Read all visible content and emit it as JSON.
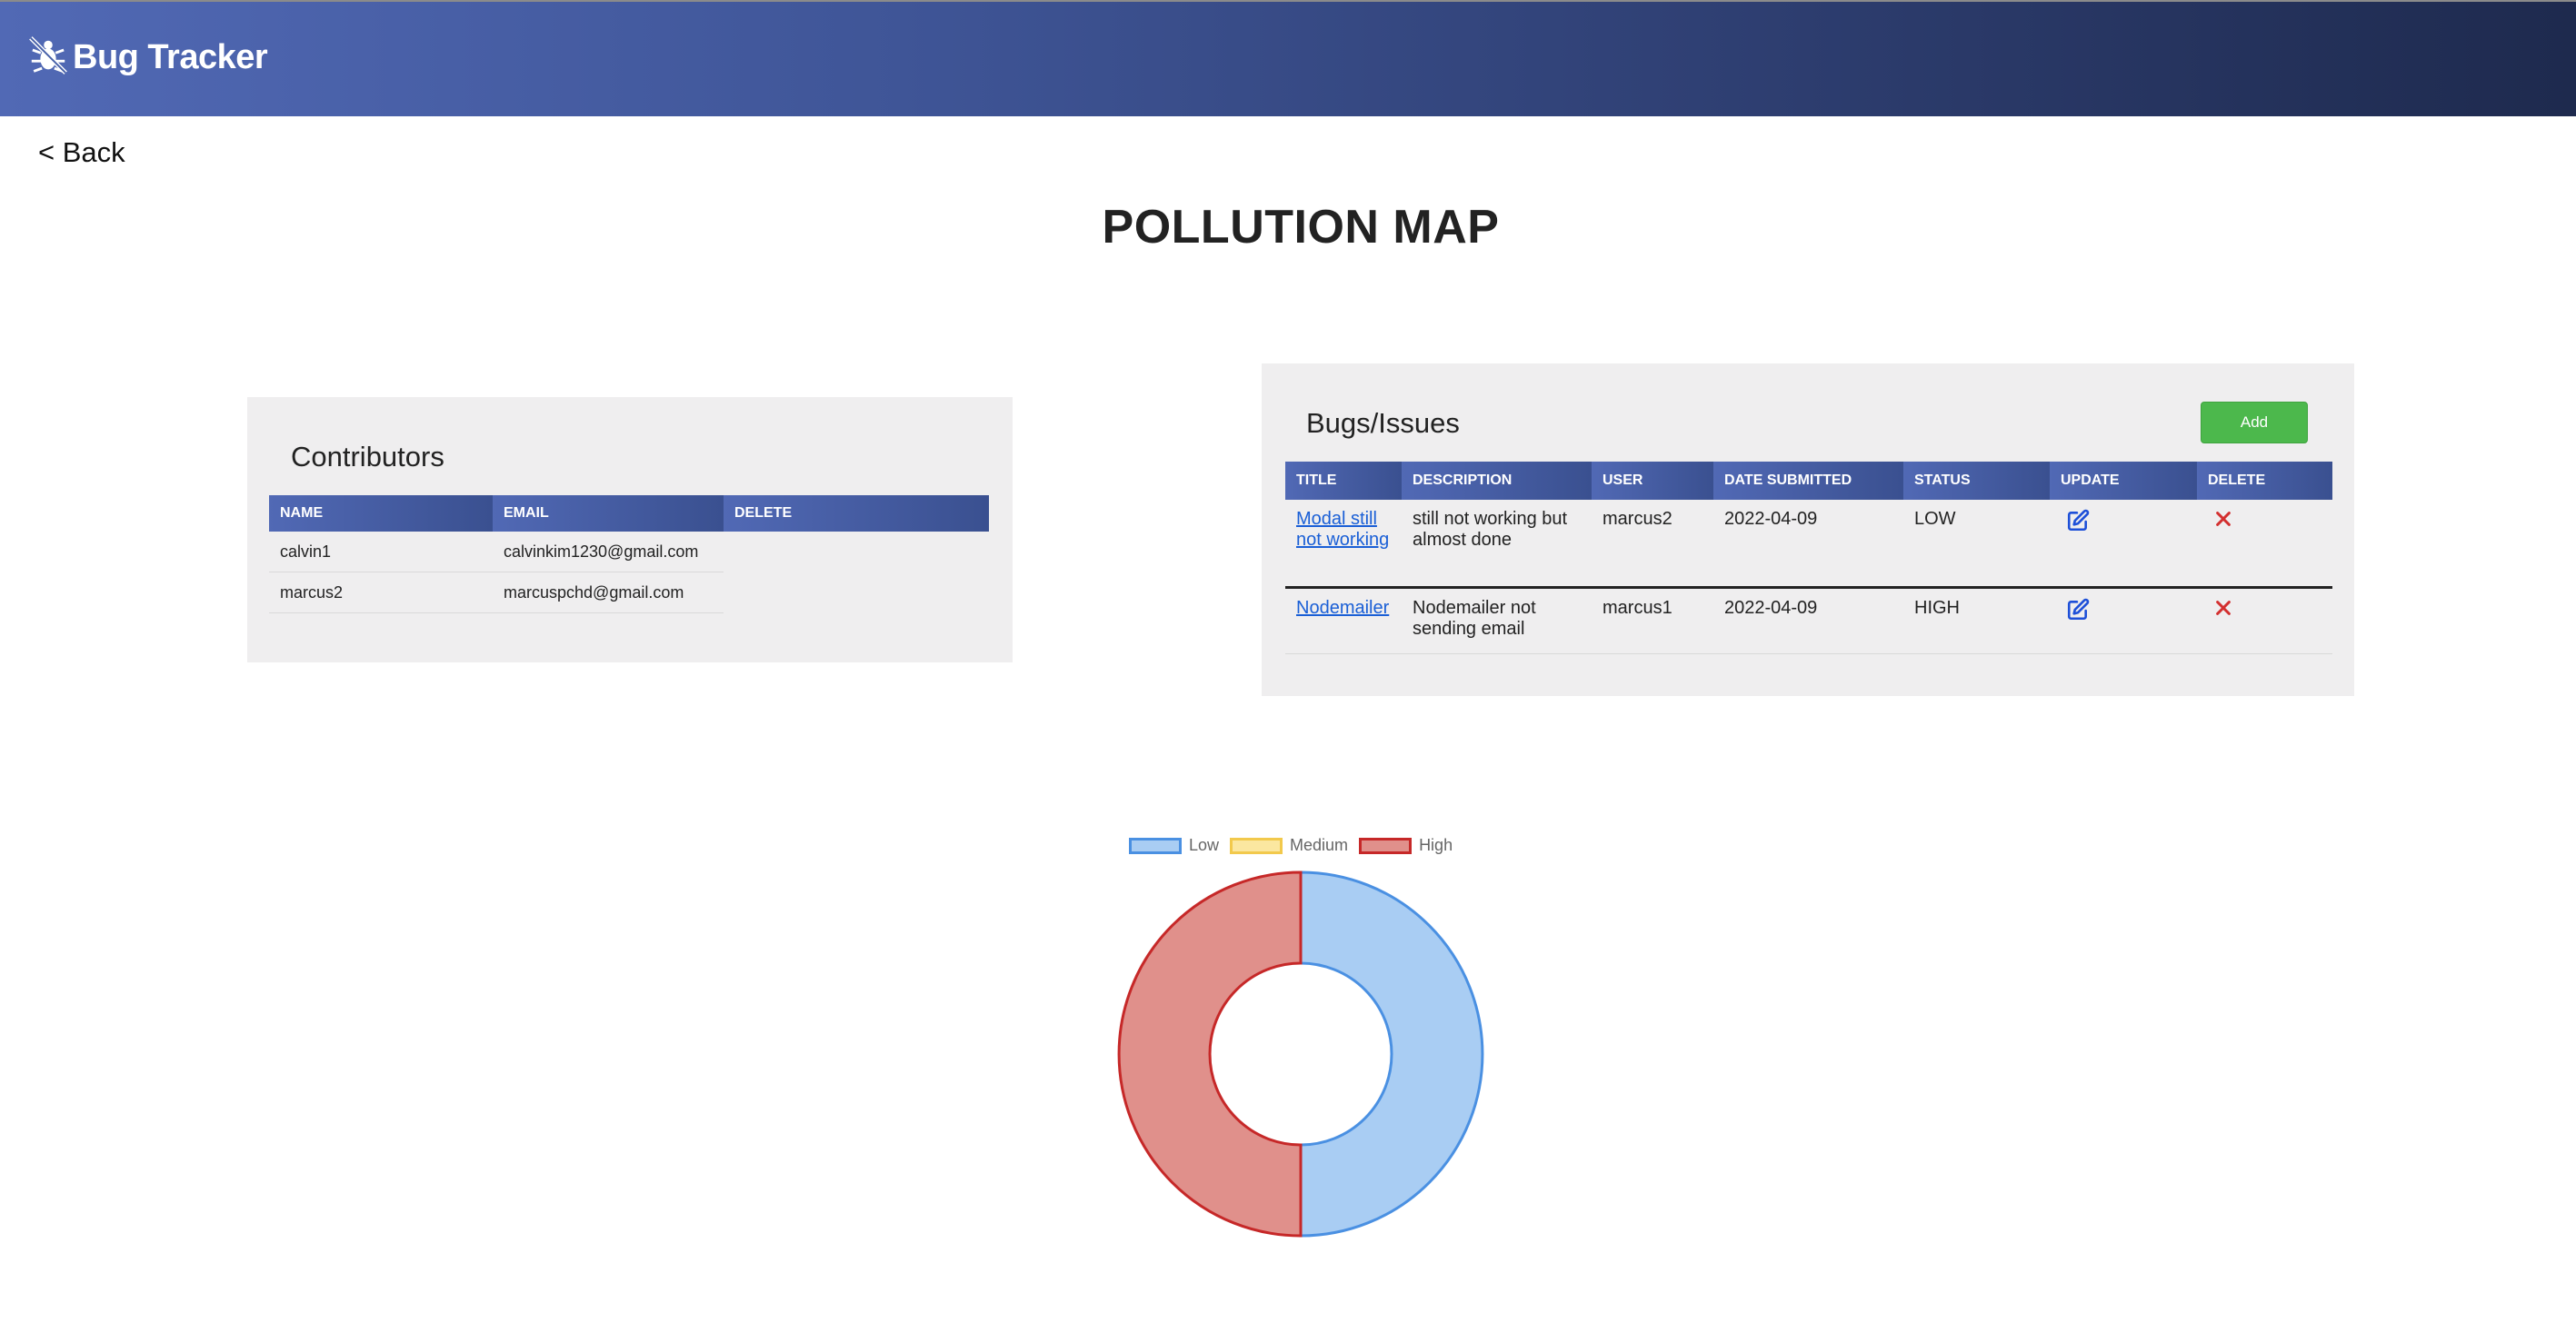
{
  "app": {
    "brand": "Bug Tracker"
  },
  "nav": {
    "back_label": "< Back"
  },
  "page": {
    "title": "POLLUTION MAP"
  },
  "contributors": {
    "title": "Contributors",
    "columns": [
      "NAME",
      "EMAIL",
      "DELETE"
    ],
    "rows": [
      {
        "name": "calvin1",
        "email": "calvinkim1230@gmail.com"
      },
      {
        "name": "marcus2",
        "email": "marcuspchd@gmail.com"
      }
    ]
  },
  "bugs": {
    "title": "Bugs/Issues",
    "add_label": "Add",
    "columns": [
      "TITLE",
      "DESCRIPTION",
      "USER",
      "DATE SUBMITTED",
      "STATUS",
      "UPDATE",
      "DELETE"
    ],
    "rows": [
      {
        "title": "Modal still not working",
        "description": "still not working but almost done",
        "user": "marcus2",
        "date": "2022-04-09",
        "status": "LOW",
        "update_icon": "edit-icon",
        "delete_icon": "close-icon"
      },
      {
        "title": "Nodemailer",
        "description": "Nodemailer not sending email",
        "user": "marcus1",
        "date": "2022-04-09",
        "status": "HIGH",
        "update_icon": "edit-icon",
        "delete_icon": "close-icon"
      }
    ]
  },
  "colors": {
    "nav_start": "#5169b5",
    "nav_end": "#1e2a4e",
    "add_button": "#4cb84c",
    "link": "#1a5fd6",
    "delete": "#d32f2f",
    "low_fill": "#a9cdf3",
    "low_border": "#4a90e2",
    "medium_fill": "#fbe7a0",
    "medium_border": "#f2c94c",
    "high_fill": "#e0908b",
    "high_border": "#c62828"
  },
  "chart_data": {
    "type": "pie",
    "variant": "doughnut",
    "categories": [
      "Low",
      "Medium",
      "High"
    ],
    "values": [
      1,
      0,
      1
    ],
    "legend_position": "top",
    "colors": [
      "#a9cdf3",
      "#fbe7a0",
      "#e0908b"
    ],
    "border_colors": [
      "#4a90e2",
      "#f2c94c",
      "#c62828"
    ]
  }
}
